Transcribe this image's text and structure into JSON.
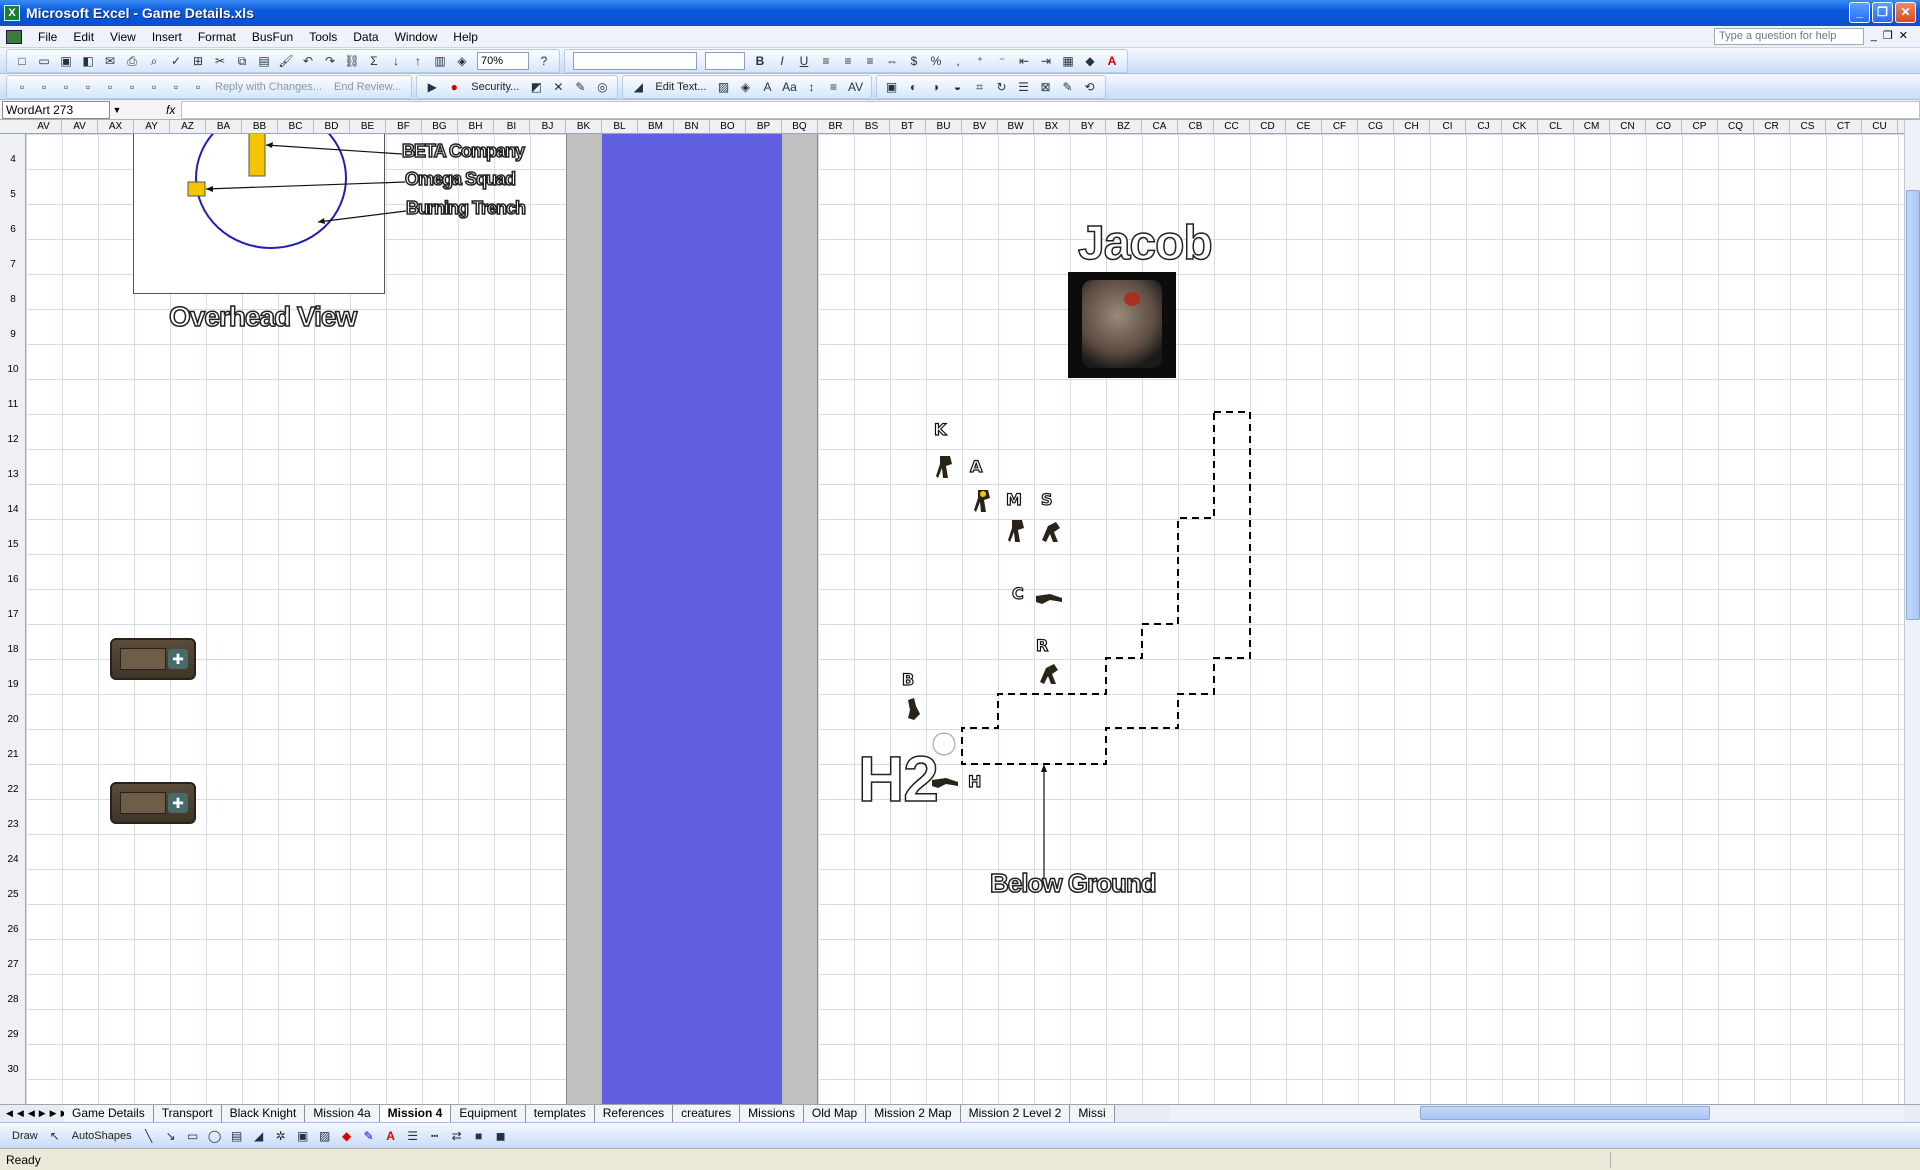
{
  "window": {
    "title": "Microsoft Excel - Game Details.xls"
  },
  "menu": [
    "File",
    "Edit",
    "View",
    "Insert",
    "Format",
    "BusFun",
    "Tools",
    "Data",
    "Window",
    "Help"
  ],
  "help_placeholder": "Type a question for help",
  "toolbar": {
    "zoom": "70%",
    "reply_label": "Reply with Changes...",
    "end_review_label": "End Review...",
    "security_label": "Security...",
    "edit_text_label": "Edit Text..."
  },
  "formula_bar": {
    "name_box": "WordArt 273",
    "fx": "fx"
  },
  "columns": [
    "AV",
    "AV",
    "AX",
    "AY",
    "AZ",
    "BA",
    "BB",
    "BC",
    "BD",
    "BE",
    "BF",
    "BG",
    "BH",
    "BI",
    "BJ",
    "BK",
    "BL",
    "BM",
    "BN",
    "BO",
    "BP",
    "BQ",
    "BR",
    "BS",
    "BT",
    "BU",
    "BV",
    "BW",
    "BX",
    "BY",
    "BZ",
    "CA",
    "CB",
    "CC",
    "CD",
    "CE",
    "CF",
    "CG",
    "CH",
    "CI",
    "CJ",
    "CK",
    "CL",
    "CM",
    "CN",
    "CO",
    "CP",
    "CQ",
    "CR",
    "CS",
    "CT",
    "CU"
  ],
  "rows": [
    "4",
    "5",
    "6",
    "7",
    "8",
    "9",
    "10",
    "11",
    "12",
    "13",
    "14",
    "15",
    "16",
    "17",
    "18",
    "19",
    "20",
    "21",
    "22",
    "23",
    "24",
    "25",
    "26",
    "27",
    "28",
    "29",
    "30"
  ],
  "overhead": {
    "caption": "Overhead View",
    "labels": [
      "BETA Company",
      "Omega Squad",
      "Burning Trench"
    ]
  },
  "map": {
    "jacob_label": "Jacob",
    "h2_label": "H2",
    "below_ground_label": "Below Ground",
    "unit_markers": [
      "K",
      "A",
      "M",
      "S",
      "C",
      "R",
      "B",
      "H"
    ]
  },
  "sheet_tabs": [
    "Game Details",
    "Transport",
    "Black Knight",
    "Mission 4a",
    "Mission 4",
    "Equipment",
    "templates",
    "References",
    "creatures",
    "Missions",
    "Old Map",
    "Mission 2 Map",
    "Mission 2 Level 2",
    "Missi"
  ],
  "active_tab": "Mission 4",
  "drawbar": {
    "draw_label": "Draw",
    "autoshapes_label": "AutoShapes"
  },
  "status": {
    "text": "Ready"
  },
  "colors": {
    "river": "#6060e0",
    "river_bank": "#c0c0c0",
    "circle": "#2020b0",
    "marker_fill": "#f5c400"
  }
}
